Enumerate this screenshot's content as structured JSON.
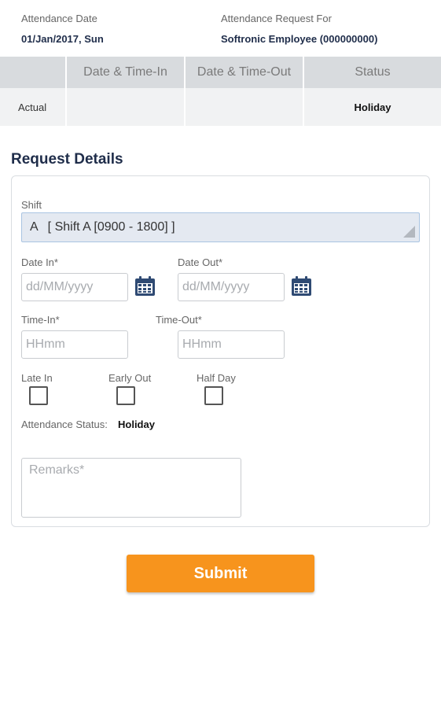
{
  "header": {
    "attendance_date_label": "Attendance Date",
    "attendance_date_value": "01/Jan/2017, Sun",
    "request_for_label": "Attendance Request For",
    "request_for_value": "Softronic Employee (000000000)"
  },
  "attendance_table": {
    "columns": [
      "",
      "Date & Time-In",
      "Date & Time-Out",
      "Status"
    ],
    "rows": [
      {
        "type": "Actual",
        "time_in": "",
        "time_out": "",
        "status": "Holiday"
      }
    ]
  },
  "request_details": {
    "title": "Request Details",
    "shift": {
      "label": "Shift",
      "code": "A",
      "value": "[ Shift A [0900 - 1800] ]"
    },
    "date_in": {
      "label": "Date In*",
      "placeholder": "dd/MM/yyyy",
      "icon": "calendar-icon"
    },
    "date_out": {
      "label": "Date Out*",
      "placeholder": "dd/MM/yyyy",
      "icon": "calendar-icon"
    },
    "time_in": {
      "label": "Time-In*",
      "placeholder": "HHmm"
    },
    "time_out": {
      "label": "Time-Out*",
      "placeholder": "HHmm"
    },
    "checkboxes": [
      {
        "label": "Late In",
        "checked": false
      },
      {
        "label": "Early Out",
        "checked": false
      },
      {
        "label": "Half Day",
        "checked": false
      }
    ],
    "attendance_status_label": "Attendance Status:",
    "attendance_status_value": "Holiday",
    "remarks_placeholder": "Remarks*"
  },
  "submit_label": "Submit",
  "colors": {
    "accent": "#f7941d",
    "title": "#1f2d4a",
    "calendar_icon": "#2f4a73",
    "table_header_bg": "#d8dbde",
    "select_bg": "#e4e9f1"
  }
}
